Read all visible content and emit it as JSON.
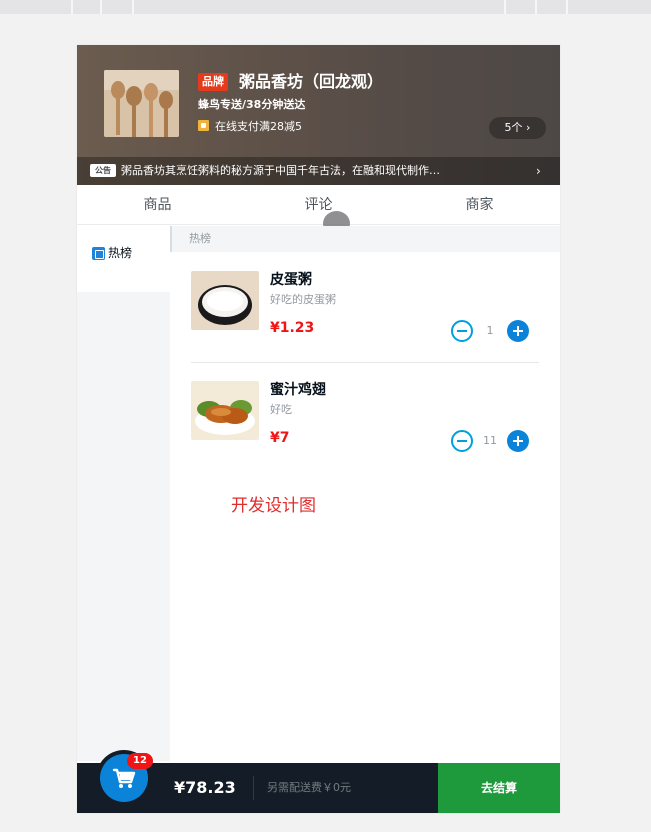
{
  "header": {
    "brand_badge": "品牌",
    "shop_name": "粥品香坊（回龙观）",
    "delivery": "蜂鸟专送/38分钟送达",
    "promotion": "在线支付满28减5",
    "coupon_count": "5个 ›",
    "bulletin_badge": "公告",
    "bulletin": "粥品香坊其烹饪粥料的秘方源于中国千年古法，在融和现代制作…",
    "bulletin_arrow": "›"
  },
  "tabs": [
    "商品",
    "评论",
    "商家"
  ],
  "menu": {
    "items": [
      {
        "label": "热榜"
      }
    ]
  },
  "section": {
    "title": "热榜"
  },
  "foods": [
    {
      "name": "皮蛋粥",
      "description": "好吃的皮蛋粥",
      "price": "¥1.23",
      "count": "1"
    },
    {
      "name": "蜜汁鸡翅",
      "description": "好吃",
      "price": "¥7",
      "count": "11"
    }
  ],
  "watermark": "开发设计图",
  "cart": {
    "badge": "12",
    "total": "¥78.23",
    "delivery_fee": "另需配送费￥0元",
    "checkout": "去结算"
  },
  "colors": {
    "accent_blue": "#0b83d8",
    "price_red": "#f01414",
    "checkout_green": "#1e9a3d",
    "cart_bar": "#141d27"
  }
}
